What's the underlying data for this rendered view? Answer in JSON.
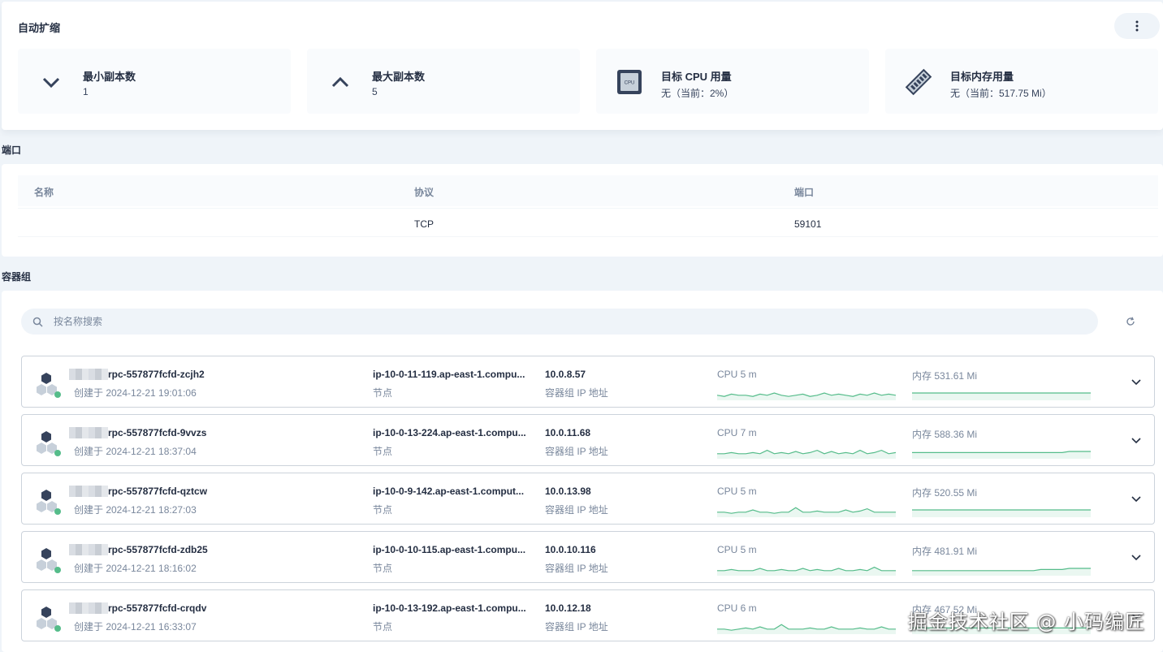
{
  "autoscale": {
    "title": "自动扩缩",
    "stats": [
      {
        "label": "最小副本数",
        "value": "1",
        "icon": "chevron-down-icon"
      },
      {
        "label": "最大副本数",
        "value": "5",
        "icon": "chevron-up-icon"
      },
      {
        "label": "目标 CPU 用量",
        "value": "无（当前：2%）",
        "icon": "cpu-icon"
      },
      {
        "label": "目标内存用量",
        "value": "无（当前：517.75 Mi）",
        "icon": "memory-icon"
      }
    ]
  },
  "ports": {
    "title": "端口",
    "columns": [
      "名称",
      "协议",
      "端口"
    ],
    "rows": [
      {
        "name": "",
        "protocol": "TCP",
        "port": "59101"
      }
    ]
  },
  "pods": {
    "title": "容器组",
    "search_placeholder": "按名称搜索",
    "items": [
      {
        "name": "rpc-557877fcfd-zcjh2",
        "created": "创建于 2024-12-21 19:01:06",
        "node": "ip-10-0-11-119.ap-east-1.compu...",
        "node_label": "节点",
        "ip": "10.0.8.57",
        "ip_label": "容器组 IP 地址",
        "cpu": "CPU 5 m",
        "mem": "内存 531.61 Mi",
        "cpu_series": [
          3,
          2,
          4,
          3,
          3,
          2,
          4,
          3,
          5,
          3,
          2,
          3,
          4,
          2,
          3,
          5,
          3,
          4,
          3,
          2,
          4,
          3,
          5,
          3,
          4,
          3
        ],
        "mem_series": [
          5,
          5,
          5,
          5,
          5,
          5,
          5,
          5,
          5,
          5,
          5,
          5,
          5,
          5,
          5,
          5,
          5,
          5,
          5,
          5,
          5,
          5,
          5,
          5,
          5,
          5
        ]
      },
      {
        "name": "rpc-557877fcfd-9vvzs",
        "created": "创建于 2024-12-21 18:37:04",
        "node": "ip-10-0-13-224.ap-east-1.compu...",
        "node_label": "节点",
        "ip": "10.0.11.68",
        "ip_label": "容器组 IP 地址",
        "cpu": "CPU 7 m",
        "mem": "内存 588.36 Mi",
        "cpu_series": [
          3,
          3,
          4,
          3,
          3,
          4,
          3,
          6,
          3,
          4,
          3,
          5,
          3,
          4,
          6,
          3,
          5,
          3,
          4,
          3,
          6,
          3,
          4,
          6,
          3,
          4
        ],
        "mem_series": [
          4,
          4,
          4,
          4,
          4,
          4,
          4,
          4,
          4,
          4,
          4,
          4,
          4,
          4,
          4,
          4,
          4,
          4,
          4,
          4,
          4,
          4,
          5,
          5,
          5,
          5
        ]
      },
      {
        "name": "rpc-557877fcfd-qztcw",
        "created": "创建于 2024-12-21 18:27:03",
        "node": "ip-10-0-9-142.ap-east-1.comput...",
        "node_label": "节点",
        "ip": "10.0.13.98",
        "ip_label": "容器组 IP 地址",
        "cpu": "CPU 5 m",
        "mem": "内存 520.55 Mi",
        "cpu_series": [
          3,
          3,
          2,
          3,
          3,
          5,
          3,
          3,
          2,
          3,
          3,
          7,
          3,
          3,
          4,
          3,
          3,
          3,
          5,
          3,
          4,
          6,
          3,
          3,
          3,
          3
        ],
        "mem_series": [
          5,
          5,
          5,
          5,
          5,
          5,
          5,
          5,
          5,
          5,
          5,
          5,
          5,
          5,
          5,
          5,
          5,
          5,
          5,
          5,
          5,
          5,
          5,
          5,
          5,
          5
        ]
      },
      {
        "name": "rpc-557877fcfd-zdb25",
        "created": "创建于 2024-12-21 18:16:02",
        "node": "ip-10-0-10-115.ap-east-1.compu...",
        "node_label": "节点",
        "ip": "10.0.10.116",
        "ip_label": "容器组 IP 地址",
        "cpu": "CPU 5 m",
        "mem": "内存 481.91 Mi",
        "cpu_series": [
          3,
          3,
          4,
          3,
          3,
          3,
          5,
          3,
          3,
          4,
          3,
          3,
          5,
          3,
          4,
          3,
          3,
          5,
          3,
          3,
          4,
          3,
          6,
          3,
          3,
          3
        ],
        "mem_series": [
          3,
          3,
          3,
          3,
          3,
          3,
          3,
          3,
          3,
          3,
          3,
          3,
          3,
          3,
          3,
          3,
          3,
          3,
          4,
          4,
          4,
          4,
          5,
          5,
          5,
          5
        ]
      },
      {
        "name": "rpc-557877fcfd-crqdv",
        "created": "创建于 2024-12-21 16:33:07",
        "node": "ip-10-0-13-192.ap-east-1.compu...",
        "node_label": "节点",
        "ip": "10.0.12.18",
        "ip_label": "容器组 IP 地址",
        "cpu": "CPU 6 m",
        "mem": "内存 467.52 Mi",
        "cpu_series": [
          3,
          3,
          2,
          3,
          4,
          3,
          5,
          3,
          3,
          7,
          3,
          3,
          3,
          4,
          3,
          3,
          5,
          3,
          3,
          3,
          4,
          3,
          3,
          5,
          3,
          3
        ],
        "mem_series": [
          4,
          4,
          4,
          4,
          4,
          4,
          4,
          4,
          4,
          4,
          4,
          4,
          4,
          4,
          4,
          4,
          4,
          4,
          4,
          4,
          4,
          4,
          4,
          4,
          4,
          4
        ]
      }
    ]
  },
  "colors": {
    "accent_green": "#55bc8a",
    "status_green": "#55bc8a",
    "pod_icon": "#36435c"
  },
  "watermark": "掘金技术社区 @ 小码编匠"
}
